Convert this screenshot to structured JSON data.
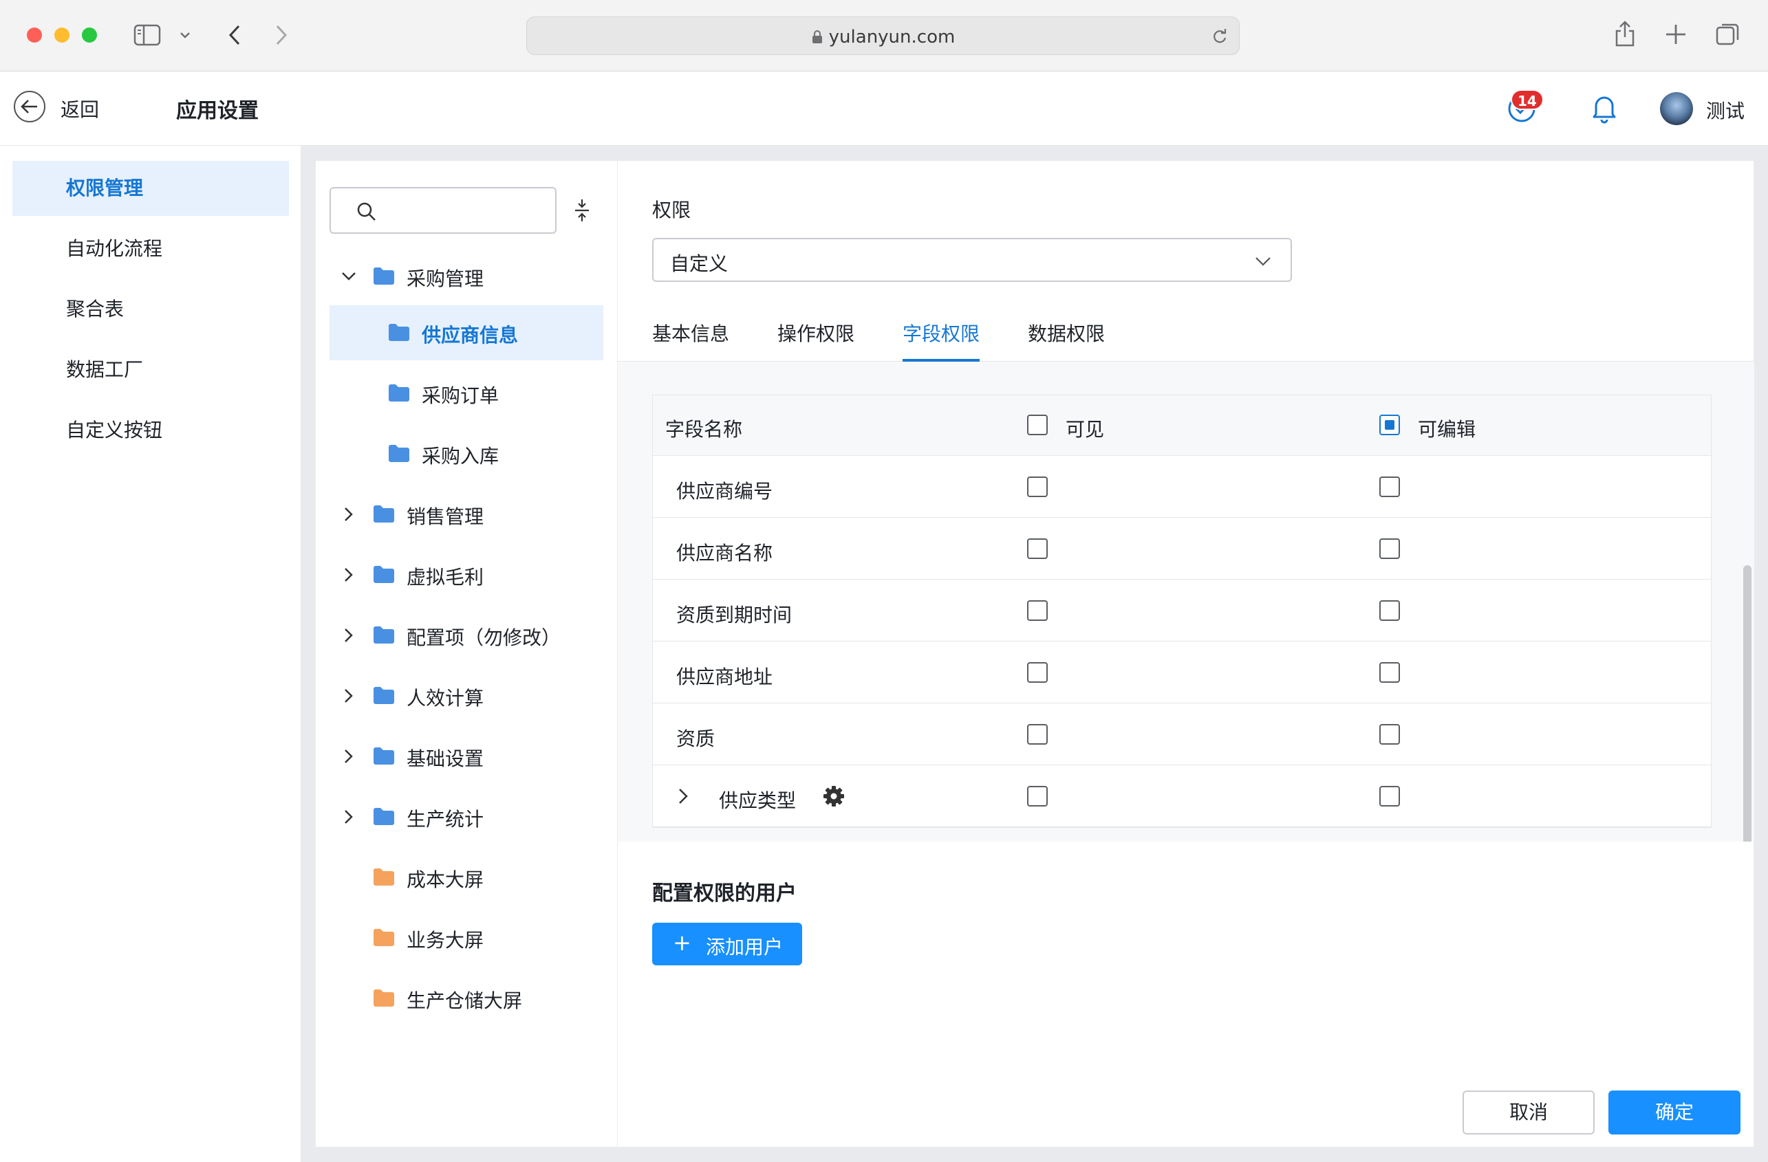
{
  "browser": {
    "url": "yulanyun.com"
  },
  "header": {
    "back_label": "返回",
    "title": "应用设置",
    "todo_count": "14",
    "user_name": "测试"
  },
  "sidebar": {
    "items": [
      {
        "label": "权限管理",
        "active": true
      },
      {
        "label": "自动化流程",
        "active": false
      },
      {
        "label": "聚合表",
        "active": false
      },
      {
        "label": "数据工厂",
        "active": false
      },
      {
        "label": "自定义按钮",
        "active": false
      }
    ]
  },
  "tree": {
    "search_placeholder": "",
    "items": [
      {
        "label": "采购管理",
        "expanded": true,
        "level": 0,
        "color": "#4a90e2"
      },
      {
        "label": "供应商信息",
        "level": 1,
        "selected": true,
        "color": "#4a90e2"
      },
      {
        "label": "采购订单",
        "level": 1,
        "color": "#4a90e2"
      },
      {
        "label": "采购入库",
        "level": 1,
        "color": "#4a90e2"
      },
      {
        "label": "销售管理",
        "expanded": false,
        "level": 0,
        "color": "#4a90e2"
      },
      {
        "label": "虚拟毛利",
        "expanded": false,
        "level": 0,
        "color": "#4a90e2"
      },
      {
        "label": "配置项（勿修改）",
        "expanded": false,
        "level": 0,
        "color": "#4a90e2"
      },
      {
        "label": "人效计算",
        "expanded": false,
        "level": 0,
        "color": "#4a90e2"
      },
      {
        "label": "基础设置",
        "expanded": false,
        "level": 0,
        "color": "#4a90e2"
      },
      {
        "label": "生产统计",
        "expanded": false,
        "level": 0,
        "color": "#4a90e2"
      },
      {
        "label": "成本大屏",
        "level": 0,
        "color": "#f5a25d"
      },
      {
        "label": "业务大屏",
        "level": 0,
        "color": "#f5a25d"
      },
      {
        "label": "生产仓储大屏",
        "level": 0,
        "color": "#f5a25d"
      }
    ]
  },
  "main": {
    "permission_label": "权限",
    "permission_value": "自定义",
    "tabs": [
      {
        "label": "基本信息",
        "active": false
      },
      {
        "label": "操作权限",
        "active": false
      },
      {
        "label": "字段权限",
        "active": true
      },
      {
        "label": "数据权限",
        "active": false
      }
    ],
    "table": {
      "col_name": "字段名称",
      "col_visible": "可见",
      "col_editable": "可编辑",
      "header_visible_checked": false,
      "header_editable_checked": true,
      "rows": [
        {
          "name": "供应商编号",
          "visible": false,
          "editable": false
        },
        {
          "name": "供应商名称",
          "visible": false,
          "editable": false
        },
        {
          "name": "资质到期时间",
          "visible": false,
          "editable": false
        },
        {
          "name": "供应商地址",
          "visible": false,
          "editable": false
        },
        {
          "name": "资质",
          "visible": false,
          "editable": false
        },
        {
          "name": "供应类型",
          "visible": false,
          "editable": false,
          "expandable": true,
          "has_settings": true
        }
      ]
    },
    "users_title": "配置权限的用户",
    "add_user_label": "添加用户",
    "cancel_label": "取消",
    "ok_label": "确定"
  },
  "colors": {
    "accent": "#1677d2",
    "primary_button": "#1890ff",
    "badge": "#e02e2e"
  }
}
